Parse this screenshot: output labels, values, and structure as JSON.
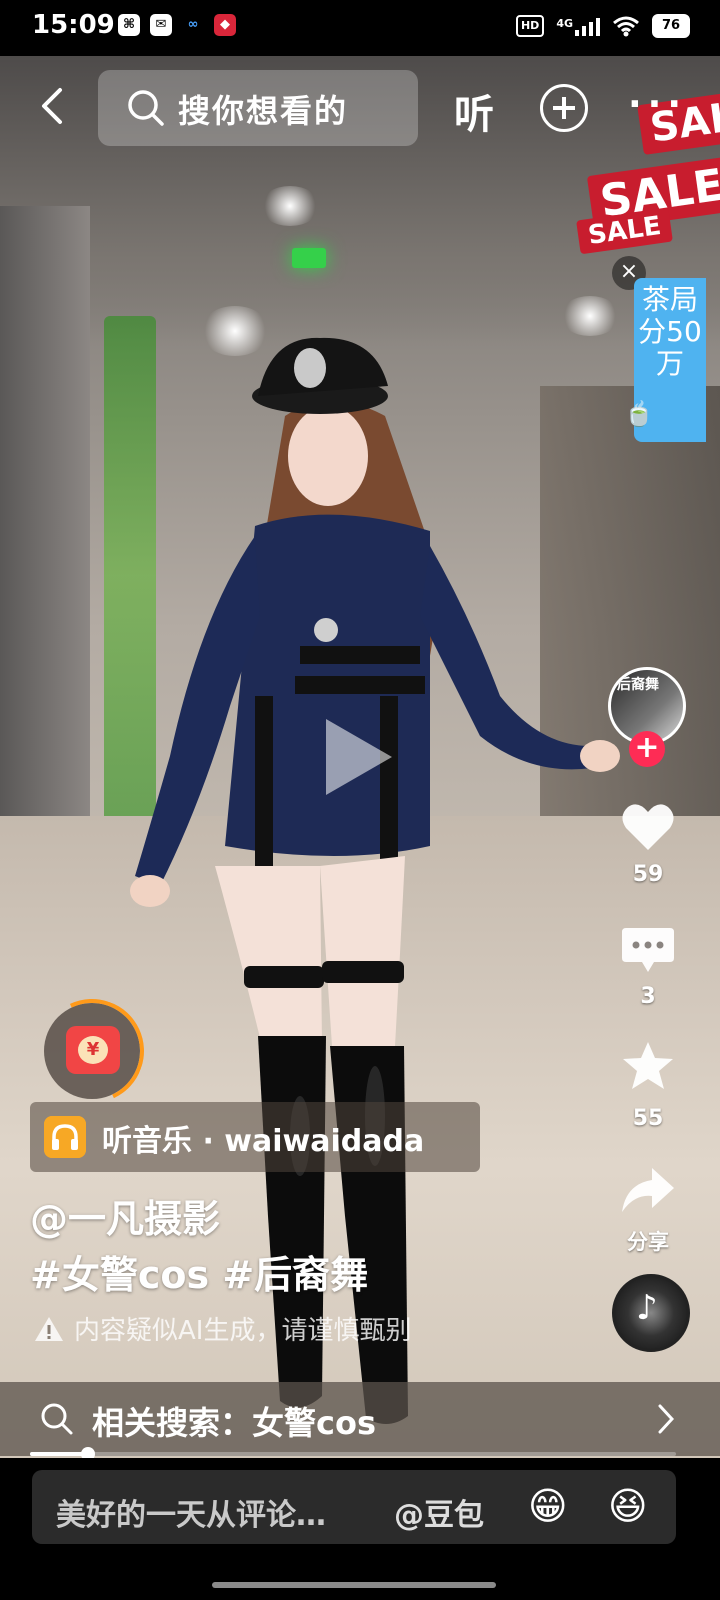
{
  "status_bar": {
    "time": "15:09",
    "network": "4G",
    "hd_badge": "HD",
    "battery": "76"
  },
  "top_nav": {
    "search_placeholder": "搜你想看的",
    "listen_label": "听",
    "more_label": "···"
  },
  "promo": {
    "close_label": "×",
    "text": "茶局分50万"
  },
  "right_rail": {
    "avatar_text": "后裔舞",
    "follow_label": "+",
    "likes": "59",
    "comments": "3",
    "favorites": "55",
    "share_label": "分享"
  },
  "music": {
    "label": "听音乐 · waiwaidada"
  },
  "post": {
    "author": "@一凡摄影",
    "tags": "#女警cos #后裔舞",
    "ai_notice": "内容疑似AI生成，请谨慎甄别"
  },
  "related_search": {
    "label": "相关搜索：女警cos"
  },
  "playback": {
    "progress_fraction": 0.09
  },
  "comment_bar": {
    "placeholder": "美好的一天从评论…",
    "mention": "@豆包",
    "emoji_1": "😁",
    "emoji_2": "😆"
  },
  "icons": {
    "back": "back-arrow-icon",
    "search": "search-icon",
    "add": "plus-circle-icon",
    "like": "heart-icon",
    "comment": "comment-bubble-icon",
    "favorite": "star-icon",
    "share": "share-arrow-icon",
    "music": "music-note-icon",
    "warning": "warning-triangle-icon"
  },
  "colors": {
    "follow_red": "#fe2c55",
    "promo_blue": "#4fb3f0",
    "headphone_orange": "#f7a825"
  }
}
